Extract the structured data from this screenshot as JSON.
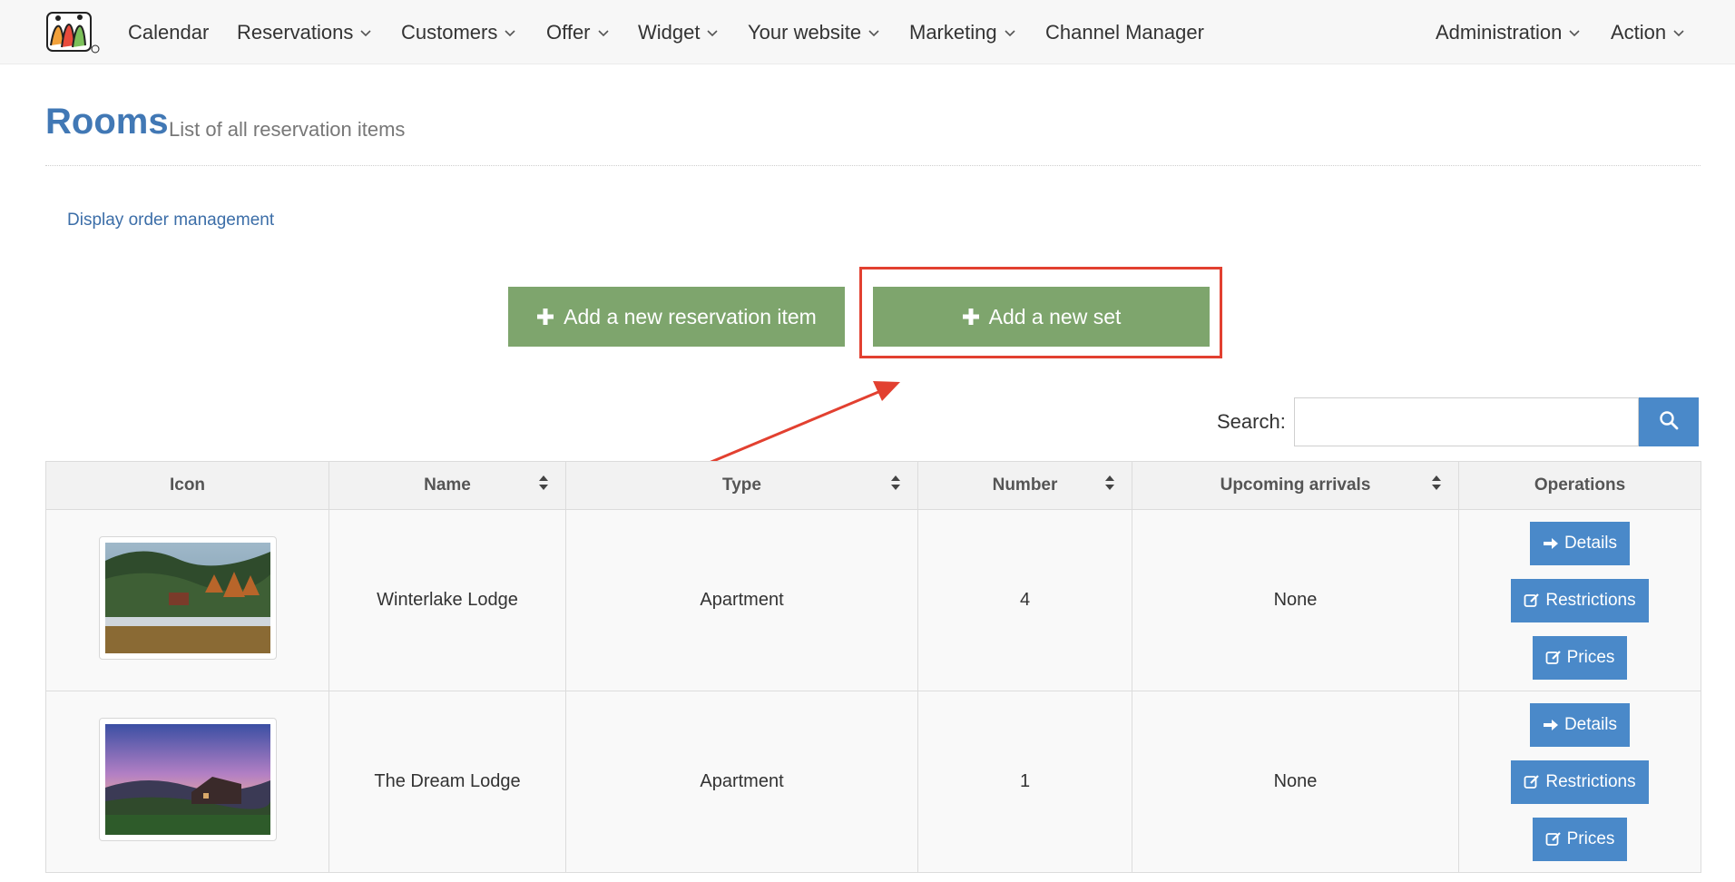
{
  "nav": {
    "logo": "app-logo",
    "items": [
      {
        "label": "Calendar",
        "dropdown": false
      },
      {
        "label": "Reservations",
        "dropdown": true
      },
      {
        "label": "Customers",
        "dropdown": true
      },
      {
        "label": "Offer",
        "dropdown": true
      },
      {
        "label": "Widget",
        "dropdown": true
      },
      {
        "label": "Your website",
        "dropdown": true
      },
      {
        "label": "Marketing",
        "dropdown": true
      },
      {
        "label": "Channel Manager",
        "dropdown": false
      }
    ],
    "right_items": [
      {
        "label": "Administration",
        "dropdown": true
      },
      {
        "label": "Action",
        "dropdown": true
      }
    ]
  },
  "page": {
    "title": "Rooms",
    "subtitle": "List of all reservation items",
    "order_link": "Display order management"
  },
  "actions": {
    "add_item_label": "Add a new reservation item",
    "add_set_label": "Add a new set",
    "highlight_color": "#e24030",
    "button_color": "#7ea56d"
  },
  "search": {
    "label": "Search:",
    "value": "",
    "placeholder": ""
  },
  "table": {
    "columns": [
      "Icon",
      "Name",
      "Type",
      "Number",
      "Upcoming arrivals",
      "Operations"
    ],
    "sortable": [
      false,
      true,
      true,
      true,
      true,
      false
    ],
    "rows": [
      {
        "icon": "lake-forest-lodge-photo",
        "name": "Winterlake Lodge",
        "type": "Apartment",
        "number": "4",
        "arrivals": "None",
        "ops": {
          "details": "Details",
          "restrictions": "Restrictions",
          "prices": "Prices"
        }
      },
      {
        "icon": "sunset-hill-lodge-photo",
        "name": "The Dream Lodge",
        "type": "Apartment",
        "number": "1",
        "arrivals": "None",
        "ops": {
          "details": "Details",
          "restrictions": "Restrictions",
          "prices": "Prices"
        }
      }
    ]
  },
  "colors": {
    "primary": "#4a89c9",
    "title": "#4178b5"
  }
}
